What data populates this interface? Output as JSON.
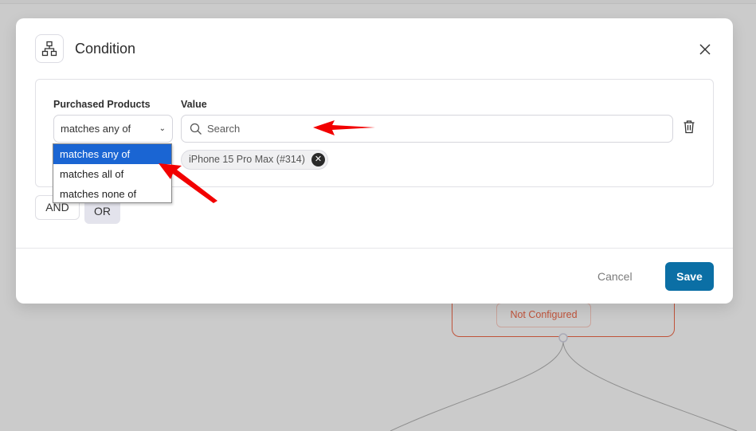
{
  "modal": {
    "title": "Condition",
    "header_icon": "sitemap-icon",
    "close_icon": "close-icon"
  },
  "rule": {
    "operator_label": "Purchased Products",
    "value_label": "Value",
    "operator_selected": "matches any of",
    "operator_options": [
      "matches any of",
      "matches all of",
      "matches none of"
    ],
    "search_placeholder": "Search",
    "search_value": "",
    "selected_values": [
      {
        "label": "iPhone 15 Pro Max (#314)"
      }
    ],
    "delete_icon": "trash-icon"
  },
  "logic": {
    "and_label": "AND",
    "or_label": "OR"
  },
  "footer": {
    "cancel_label": "Cancel",
    "save_label": "Save"
  },
  "background": {
    "node_status": "Not Configured"
  },
  "colors": {
    "accent": "#0b6fa5",
    "dropdown_highlight": "#1a65d3",
    "status_red": "#c0533a",
    "annotation_arrow": "#ff0000"
  }
}
